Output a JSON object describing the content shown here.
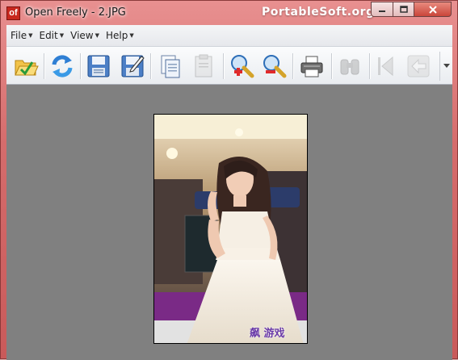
{
  "window": {
    "logo_text": "of",
    "title": "Open Freely - 2.JPG",
    "watermark": "PortableSoft.org"
  },
  "menubar": {
    "items": [
      {
        "label": "File"
      },
      {
        "label": "Edit"
      },
      {
        "label": "View"
      },
      {
        "label": "Help"
      }
    ]
  },
  "toolbar": {
    "buttons": [
      {
        "icon": "open-folder-icon",
        "enabled": true
      },
      {
        "icon": "refresh-icon",
        "enabled": true
      },
      {
        "icon": "save-icon",
        "enabled": true
      },
      {
        "icon": "save-as-icon",
        "enabled": true
      },
      {
        "icon": "copy-icon",
        "enabled": true
      },
      {
        "icon": "paste-icon",
        "enabled": false
      },
      {
        "icon": "zoom-in-icon",
        "enabled": true
      },
      {
        "icon": "zoom-out-icon",
        "enabled": true
      },
      {
        "icon": "print-icon",
        "enabled": true
      },
      {
        "icon": "find-icon",
        "enabled": false
      },
      {
        "icon": "previous-icon",
        "enabled": false
      },
      {
        "icon": "back-icon",
        "enabled": false
      }
    ]
  },
  "image": {
    "filename": "2.JPG",
    "watermark_text": "飙 游戏"
  },
  "colors": {
    "titlebar": "#d56c6c",
    "client_bg": "#808080",
    "close_button": "#c9453a"
  }
}
